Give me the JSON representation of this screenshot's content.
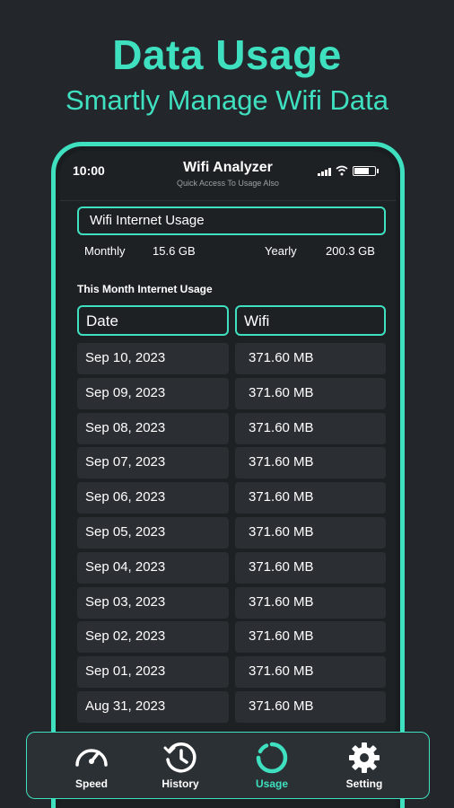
{
  "hero": {
    "title": "Data Usage",
    "subtitle": "Smartly Manage Wifi Data"
  },
  "statusbar": {
    "time": "10:00"
  },
  "app": {
    "title": "Wifi Analyzer",
    "subtitle": "Quick Access To Usage Also"
  },
  "usage_box": {
    "label": "Wifi Internet Usage"
  },
  "summary": {
    "monthly_label": "Monthly",
    "monthly_value": "15.6 GB",
    "yearly_label": "Yearly",
    "yearly_value": "200.3 GB"
  },
  "table": {
    "title": "This Month Internet Usage",
    "headers": [
      "Date",
      "Wifi"
    ],
    "rows": [
      [
        "Sep 10, 2023",
        "371.60 MB"
      ],
      [
        "Sep 09, 2023",
        "371.60 MB"
      ],
      [
        "Sep 08, 2023",
        "371.60 MB"
      ],
      [
        "Sep 07, 2023",
        "371.60 MB"
      ],
      [
        "Sep 06, 2023",
        "371.60 MB"
      ],
      [
        "Sep 05, 2023",
        "371.60 MB"
      ],
      [
        "Sep 04, 2023",
        "371.60 MB"
      ],
      [
        "Sep 03, 2023",
        "371.60 MB"
      ],
      [
        "Sep 02, 2023",
        "371.60 MB"
      ],
      [
        "Sep 01, 2023",
        "371.60 MB"
      ],
      [
        "Aug 31, 2023",
        "371.60 MB"
      ]
    ]
  },
  "nav": {
    "items": [
      {
        "label": "Speed",
        "icon": "speedometer-icon",
        "active": false
      },
      {
        "label": "History",
        "icon": "history-icon",
        "active": false
      },
      {
        "label": "Usage",
        "icon": "usage-ring-icon",
        "active": true
      },
      {
        "label": "Setting",
        "icon": "gear-icon",
        "active": false
      }
    ]
  },
  "colors": {
    "accent": "#3fe0c0",
    "background": "#23272b",
    "cell": "#2b2f33"
  }
}
